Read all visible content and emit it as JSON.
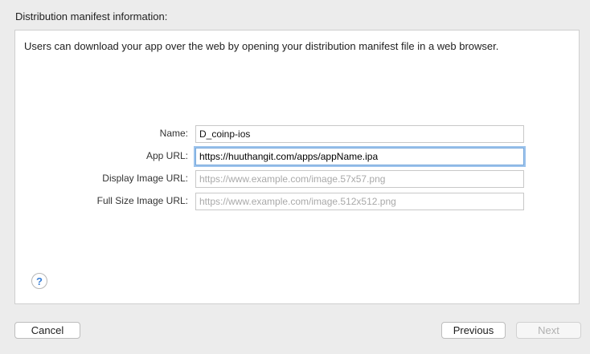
{
  "section": {
    "title": "Distribution manifest information:"
  },
  "panel": {
    "description": "Users can download your app over the web by opening your distribution manifest file in a web browser."
  },
  "form": {
    "name": {
      "label": "Name:",
      "value": "D_coinp-ios",
      "placeholder": ""
    },
    "app_url": {
      "label": "App URL:",
      "value": "https://huuthangit.com/apps/appName.ipa",
      "placeholder": ""
    },
    "display_image_url": {
      "label": "Display Image URL:",
      "value": "",
      "placeholder": "https://www.example.com/image.57x57.png"
    },
    "full_size_image_url": {
      "label": "Full Size Image URL:",
      "value": "",
      "placeholder": "https://www.example.com/image.512x512.png"
    }
  },
  "help": {
    "glyph": "?",
    "icon": "question-mark-icon",
    "color": "#3a7fd5"
  },
  "buttons": {
    "cancel": "Cancel",
    "previous": "Previous",
    "next": "Next"
  },
  "colors": {
    "focus_ring": "#9cc3ec",
    "background": "#ececec",
    "panel": "#ffffff"
  }
}
